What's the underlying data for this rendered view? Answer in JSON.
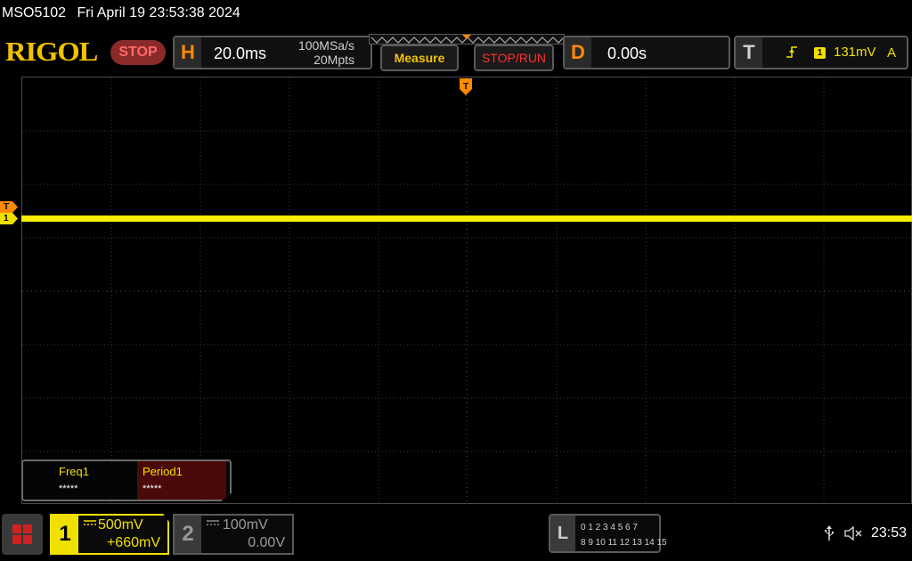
{
  "titlebar": {
    "model": "MSO5102",
    "datetime": "Fri April 19 23:53:38 2024"
  },
  "header": {
    "logo": "RIGOL",
    "run_state": "STOP",
    "horizontal": {
      "letter": "H",
      "timebase": "20.0ms",
      "sample_rate": "100MSa/s",
      "memory_depth": "20Mpts"
    },
    "buttons": {
      "measure": "Measure",
      "stop_run": "STOP/RUN"
    },
    "delay": {
      "letter": "D",
      "value": "0.00s"
    },
    "trigger": {
      "letter": "T",
      "edge_icon": "rising-edge-icon",
      "source": "1",
      "level": "131mV",
      "mode": "A"
    }
  },
  "screen": {
    "trigger_marker_top": "T",
    "left_trigger_marker": "T",
    "ch1_marker": "1",
    "trace_color": "#f7ee00"
  },
  "measurements": [
    {
      "label": "Freq1",
      "value": "*****"
    },
    {
      "label": "Period1",
      "value": "*****"
    }
  ],
  "channels": {
    "ch1": {
      "number": "1",
      "coupling": "DC",
      "scale": "500mV",
      "offset": "+660mV",
      "color": "#f0e000"
    },
    "ch2": {
      "number": "2",
      "coupling": "DC",
      "scale": "100mV",
      "offset": "0.00V",
      "color": "#9a9a9a"
    }
  },
  "logic": {
    "letter": "L",
    "row1": "0 1 2 3   4 5 6 7",
    "row2": "8  9 10 11  12 13 14 15"
  },
  "status": {
    "usb_icon": "usb-icon",
    "sound_icon": "mute-icon",
    "time": "23:53"
  }
}
